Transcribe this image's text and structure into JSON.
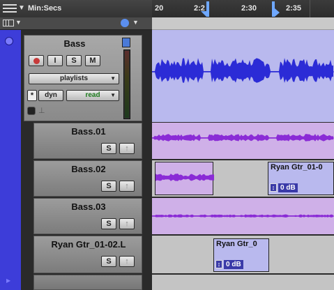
{
  "ruler": {
    "format_label": "Min:Secs",
    "ticks": [
      "20",
      "2:2",
      "2:30",
      "2:35"
    ]
  },
  "main_track": {
    "name": "Bass",
    "record_btn": "",
    "input_btn": "I",
    "solo_btn": "S",
    "mute_btn": "M",
    "playlists_label": "playlists",
    "automation_star": "*",
    "automation_param": "dyn",
    "automation_mode": "read"
  },
  "playlist_tracks": [
    {
      "name": "Bass.01",
      "solo": "S"
    },
    {
      "name": "Bass.02",
      "solo": "S"
    },
    {
      "name": "Bass.03",
      "solo": "S"
    },
    {
      "name": "Ryan Gtr_01-02.L",
      "solo": "S"
    }
  ],
  "clips": {
    "clip_a_title": "Ryan Gtr_01-0",
    "clip_a_gain": "0 dB",
    "clip_b_title": "Ryan Gtr_0",
    "clip_b_gain": "0 dB"
  },
  "colors": {
    "main_wave": "#2b2bd6",
    "alt_wave": "#8a2bd6",
    "lane_blue": "#b9b9ee",
    "lane_purple": "#cfb0e8"
  }
}
